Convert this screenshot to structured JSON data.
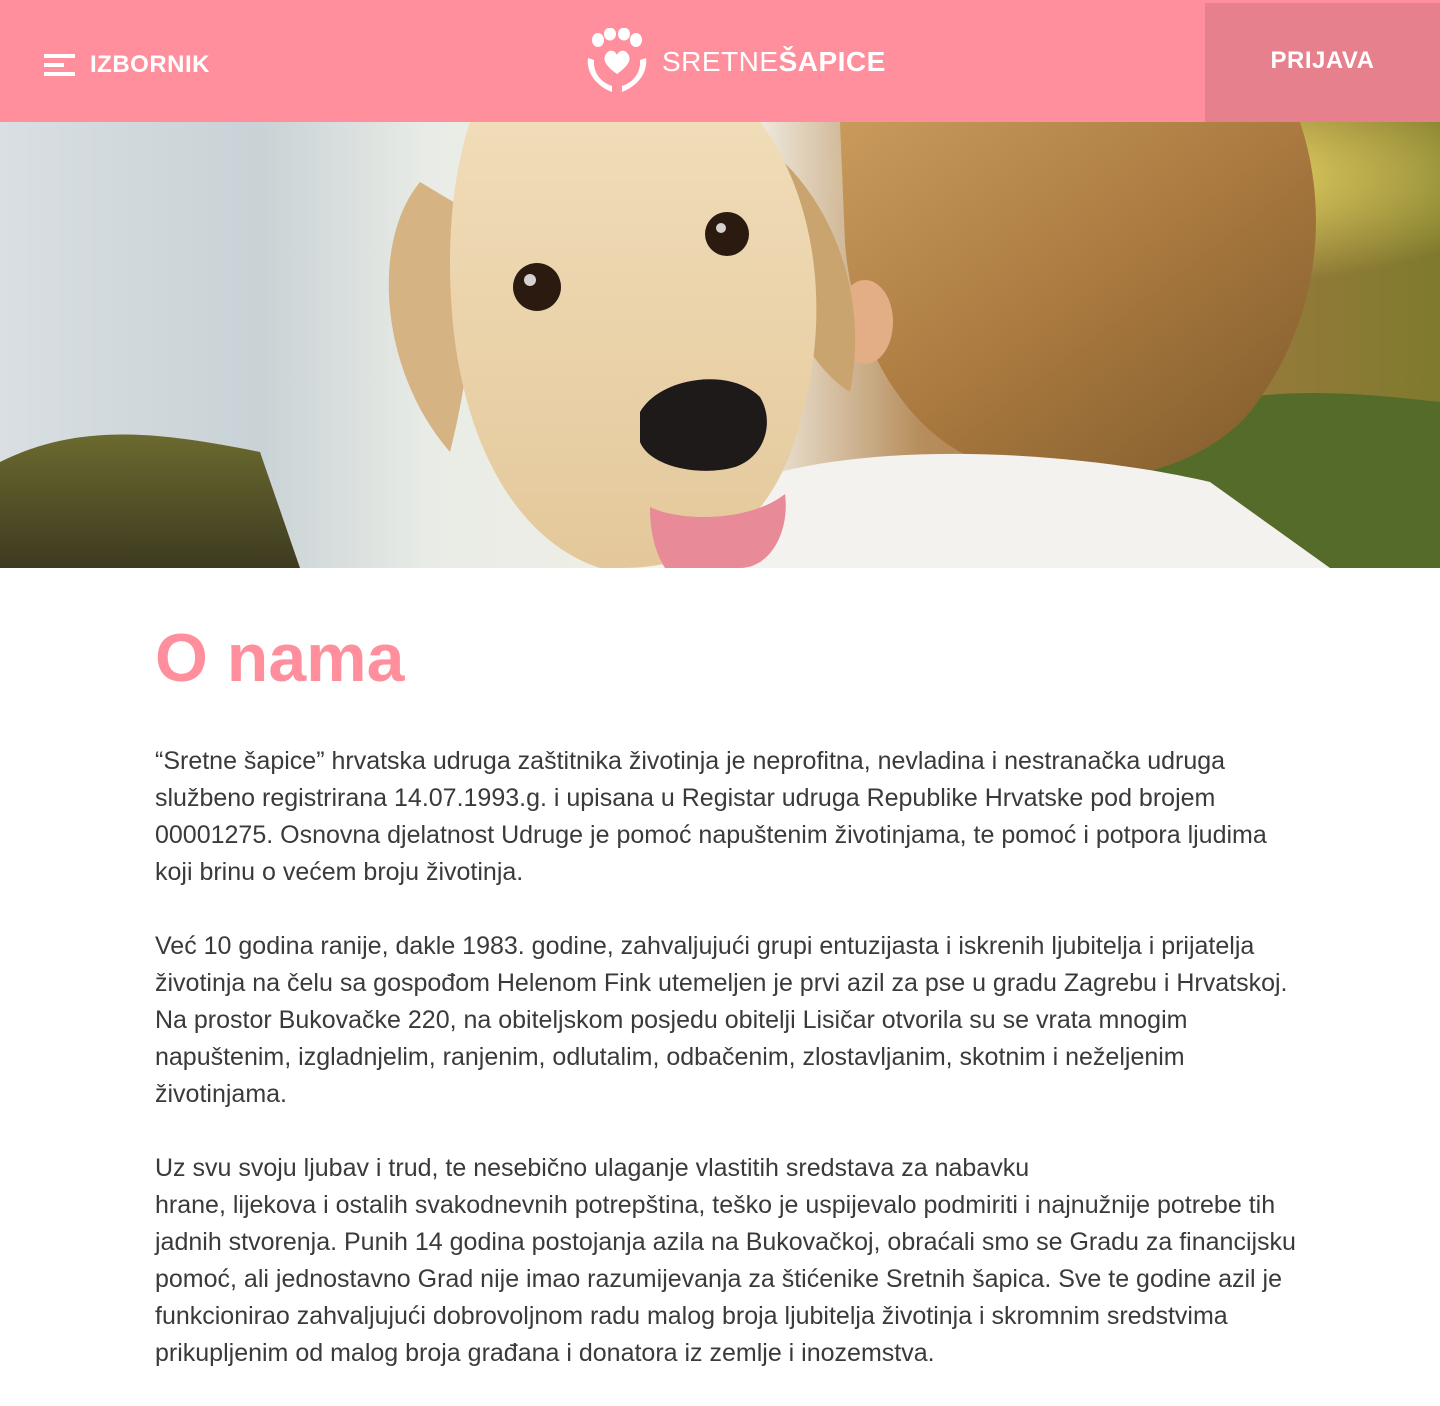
{
  "header": {
    "menu_label": "IZBORNIK",
    "logo_light": "SRETNE",
    "logo_bold": "ŠAPICE",
    "login_label": "PRIJAVA"
  },
  "colors": {
    "brand_pink": "#ff8f9c",
    "login_bg": "#e6808c",
    "title_pink": "#ff8f9c"
  },
  "icons": {
    "menu": "hamburger-icon",
    "logo": "paw-heart-hands-logo"
  },
  "main": {
    "title": "O nama",
    "paragraphs": [
      "“Sretne šapice” hrvatska udruga zaštitnika životinja je neprofitna, nevladina i nestranačka udruga službeno registrirana 14.07.1993.g. i upisana u Registar udruga Republike Hrvatske pod brojem 00001275. Osnovna djelatnost Udruge je pomoć napuštenim životinjama, te pomoć i potpora ljudima koji brinu o većem broju životinja.",
      "Već 10 godina ranije, dakle 1983. godine, zahvaljujući grupi entuzijasta i iskrenih ljubitelja i prijatelja životinja na čelu sa gospođom Helenom Fink utemeljen je prvi azil za pse u gradu Zagrebu i Hrvatskoj. Na prostor Bukovačke 220, na obiteljskom posjedu obitelji Lisičar otvorila su se vrata  mnogim napuštenim, izgladnjelim, ranjenim, odlutalim, odbačenim, zlostavljanim, skotnim i neželjenim životinjama.",
      "Uz svu svoju ljubav i trud, te nesebično ulaganje vlastitih sredstava za nabavku\n hrane, lijekova i ostalih svakodnevnih potrepština, teško je uspijevalo podmiriti i najnužnije potrebe tih jadnih stvorenja.  Punih 14 godina postojanja azila na Bukovačkoj, obraćali smo se Gradu za financijsku pomoć, ali jednostavno Grad nije imao razumijevanja za štićenike Sretnih šapica. Sve te godine azil je funkcionirao zahvaljujući dobrovoljnom radu malog broja ljubitelja životinja i skromnim sredstvima prikupljenim od malog broja građana i donatora iz zemlje i inozemstva."
    ]
  }
}
